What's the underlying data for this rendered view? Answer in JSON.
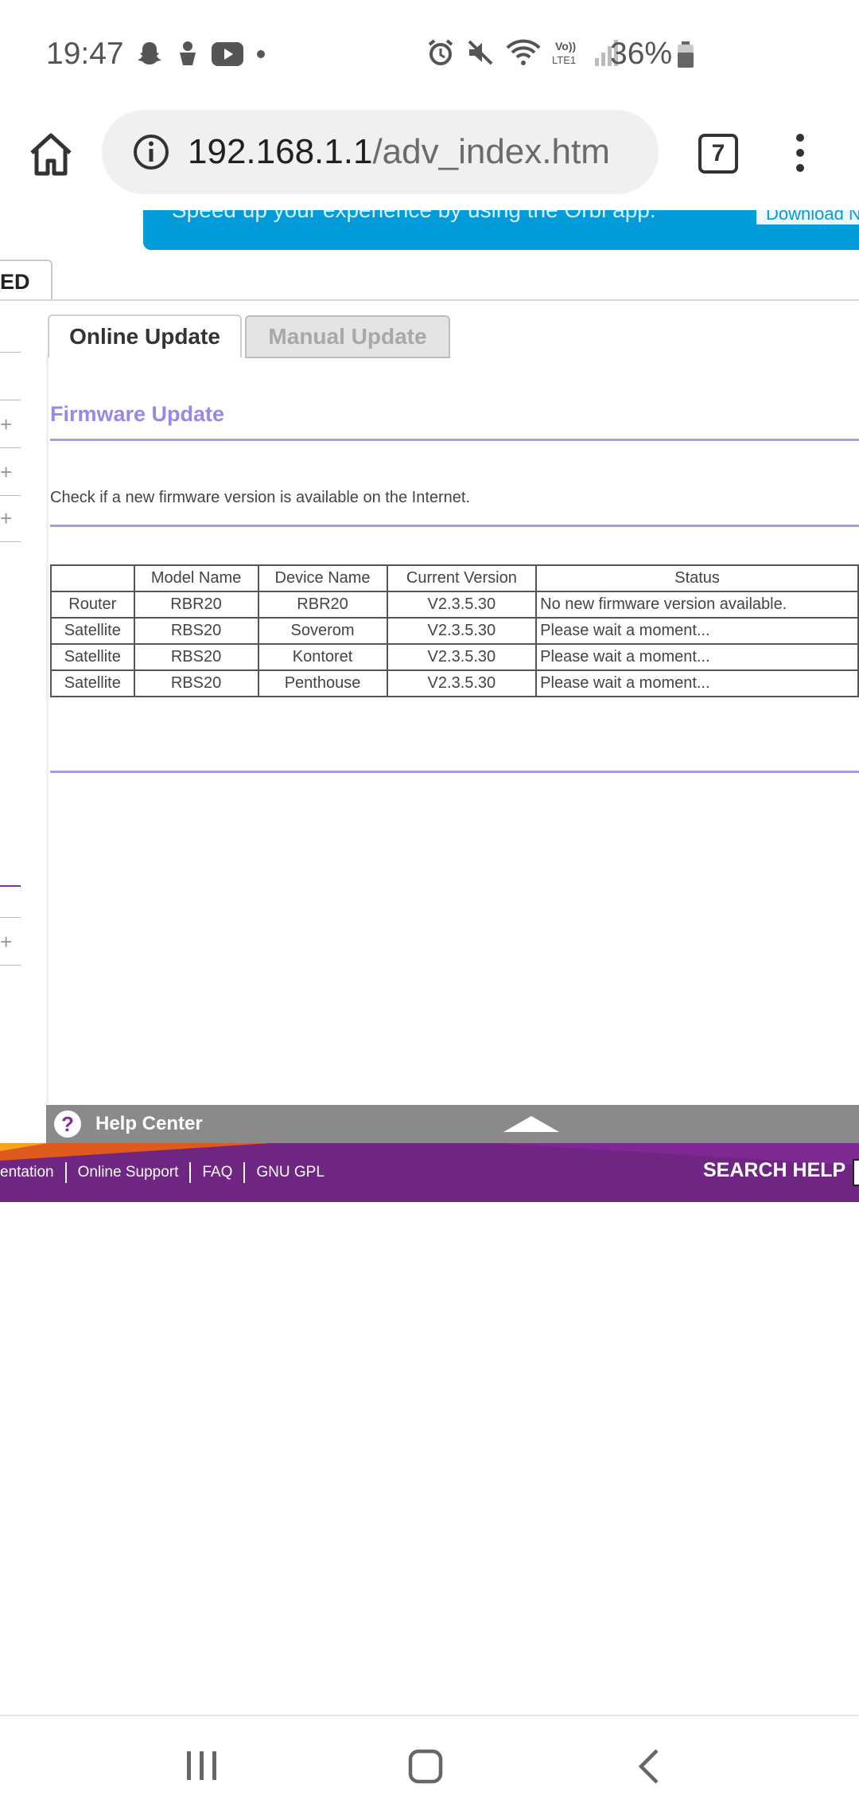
{
  "status_bar": {
    "time": "19:47",
    "battery": "36%",
    "left_icons": [
      "snapchat-icon",
      "android-bot-icon",
      "youtube-icon",
      "dot-icon"
    ],
    "right_icons": [
      "alarm-icon",
      "mute-icon",
      "wifi-icon",
      "volte-icon",
      "signal-icon",
      "battery-icon"
    ]
  },
  "browser": {
    "url_host": "192.168.1.1",
    "url_path": "/adv_index.htm",
    "tab_count": "7"
  },
  "banner": {
    "text": "Speed up your experience by using the Orbi app.",
    "button": "Download N"
  },
  "nav": {
    "advanced_tab": "ED"
  },
  "tabs": [
    {
      "label": "Online Update",
      "active": true
    },
    {
      "label": "Manual Update",
      "active": false
    }
  ],
  "section": {
    "title": "Firmware Update",
    "description": "Check if a new firmware version is available on the Internet."
  },
  "table": {
    "headers": [
      "",
      "Model Name",
      "Device Name",
      "Current Version",
      "Status"
    ],
    "rows": [
      [
        "Router",
        "RBR20",
        "RBR20",
        "V2.3.5.30",
        "No new firmware version available."
      ],
      [
        "Satellite",
        "RBS20",
        "Soverom",
        "V2.3.5.30",
        "Please wait a moment..."
      ],
      [
        "Satellite",
        "RBS20",
        "Kontoret",
        "V2.3.5.30",
        "Please wait a moment..."
      ],
      [
        "Satellite",
        "RBS20",
        "Penthouse",
        "V2.3.5.30",
        "Please wait a moment..."
      ]
    ]
  },
  "help": {
    "label": "Help Center"
  },
  "footer": {
    "links": [
      "entation",
      "Online Support",
      "FAQ",
      "GNU GPL"
    ],
    "search_label": "SEARCH HELP"
  },
  "colors": {
    "accent_purple": "#9b87e6",
    "footer_purple": "#6f2683",
    "banner_blue": "#019cd9"
  }
}
